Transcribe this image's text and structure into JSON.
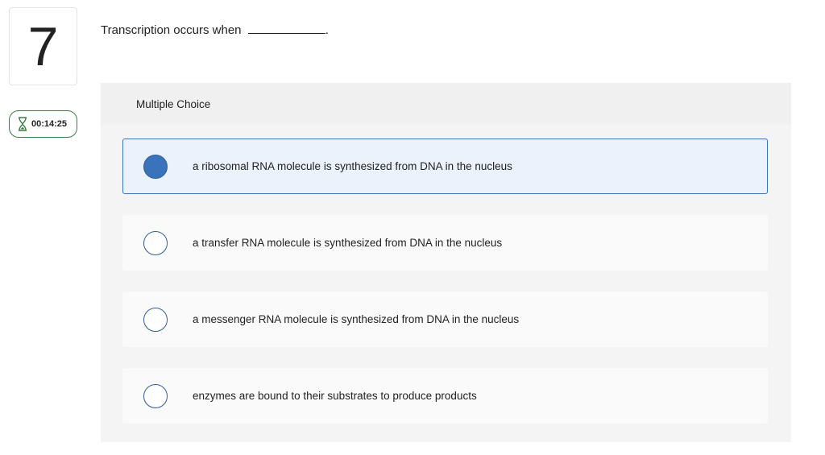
{
  "question": {
    "number": "7",
    "prompt_text": "Transcription occurs when",
    "prompt_end": "."
  },
  "timer": {
    "icon": "hourglass-icon",
    "value": "00:14:25",
    "color": "#3a7d44"
  },
  "panel": {
    "header": "Multiple Choice",
    "choices": [
      {
        "label": "a ribosomal RNA molecule is synthesized from DNA in the nucleus",
        "selected": true
      },
      {
        "label": "a transfer RNA molecule is synthesized from DNA in the nucleus",
        "selected": false
      },
      {
        "label": "a messenger RNA molecule is synthesized from DNA in the nucleus",
        "selected": false
      },
      {
        "label": "enzymes are bound to their substrates to produce products",
        "selected": false
      }
    ]
  },
  "colors": {
    "selected_fill": "#3a73bb",
    "selected_border": "#3e74b6",
    "selected_background": "#eaf2fb"
  }
}
